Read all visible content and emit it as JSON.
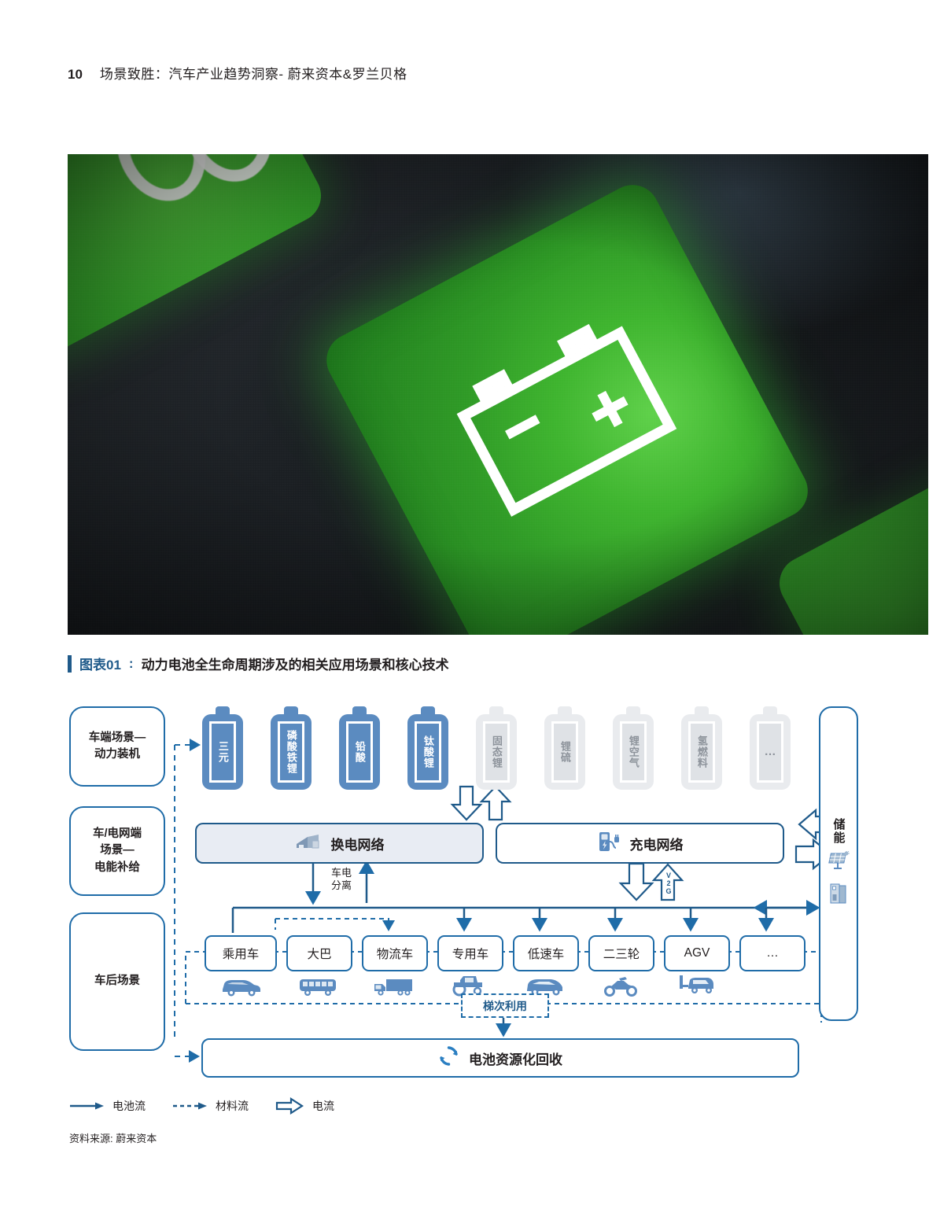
{
  "page": {
    "number": "10",
    "header_title": "场景致胜：汽车产业趋势洞察- 蔚来资本&罗兰贝格"
  },
  "photo": {
    "alt": "绿色电池图标按键特写照片",
    "icon": "battery-icon"
  },
  "figure": {
    "number": "图表01",
    "separator": ":",
    "title": "动力电池全生命周期涉及的相关应用场景和核心技术",
    "source": "资料来源: 蔚来资本"
  },
  "diagram": {
    "stages": [
      {
        "id": "stage-vehicle-power",
        "label": "车端场景—\n动力装机"
      },
      {
        "id": "stage-grid-energy",
        "label": "车/电网端\n场景—\n电能补给"
      },
      {
        "id": "stage-after-vehicle",
        "label": "车后场景"
      }
    ],
    "batteries": [
      {
        "label": "三元",
        "active": true
      },
      {
        "label": "磷酸铁锂",
        "active": true
      },
      {
        "label": "铅酸",
        "active": true
      },
      {
        "label": "钛酸锂",
        "active": true
      },
      {
        "label": "固态锂",
        "active": false
      },
      {
        "label": "锂硫",
        "active": false
      },
      {
        "label": "锂空气",
        "active": false
      },
      {
        "label": "氢燃料",
        "active": false
      },
      {
        "label": "…",
        "active": false
      }
    ],
    "networks": [
      {
        "id": "swap-network",
        "label": "换电网络",
        "icon": "swap-station-icon"
      },
      {
        "id": "charge-network",
        "label": "充电网络",
        "icon": "charging-pile-icon"
      }
    ],
    "storage": {
      "label": "储能",
      "icons": [
        "solar-panel-icon",
        "battery-cabinet-icon"
      ]
    },
    "flow_labels": {
      "battery_separation": "车电\n分离",
      "v2g": "V2G",
      "ladder_use": "梯次利用"
    },
    "vehicles": [
      {
        "label": "乘用车",
        "icon": "car-icon"
      },
      {
        "label": "大巴",
        "icon": "bus-icon"
      },
      {
        "label": "物流车",
        "icon": "truck-icon"
      },
      {
        "label": "专用车",
        "icon": "tractor-icon"
      },
      {
        "label": "低速车",
        "icon": "microcar-icon"
      },
      {
        "label": "二三轮",
        "icon": "motorcycle-icon"
      },
      {
        "label": "AGV",
        "icon": "agv-icon"
      },
      {
        "label": "…",
        "icon": ""
      }
    ],
    "recycle": {
      "label": "电池资源化回收",
      "icon": "recycle-icon"
    },
    "legend": [
      {
        "type": "solid-arrow",
        "label": "电池流"
      },
      {
        "type": "dashed-arrow",
        "label": "材料流"
      },
      {
        "type": "block-arrow",
        "label": "电流"
      }
    ]
  },
  "colors": {
    "accent_blue": "#1f5a8a",
    "line_blue": "#1f6ca8",
    "battery_fill": "#5b8bc0",
    "panel_fill": "#e8ecf3",
    "inactive_gray": "#dfe2e6",
    "photo_green": "#3fb52f"
  }
}
